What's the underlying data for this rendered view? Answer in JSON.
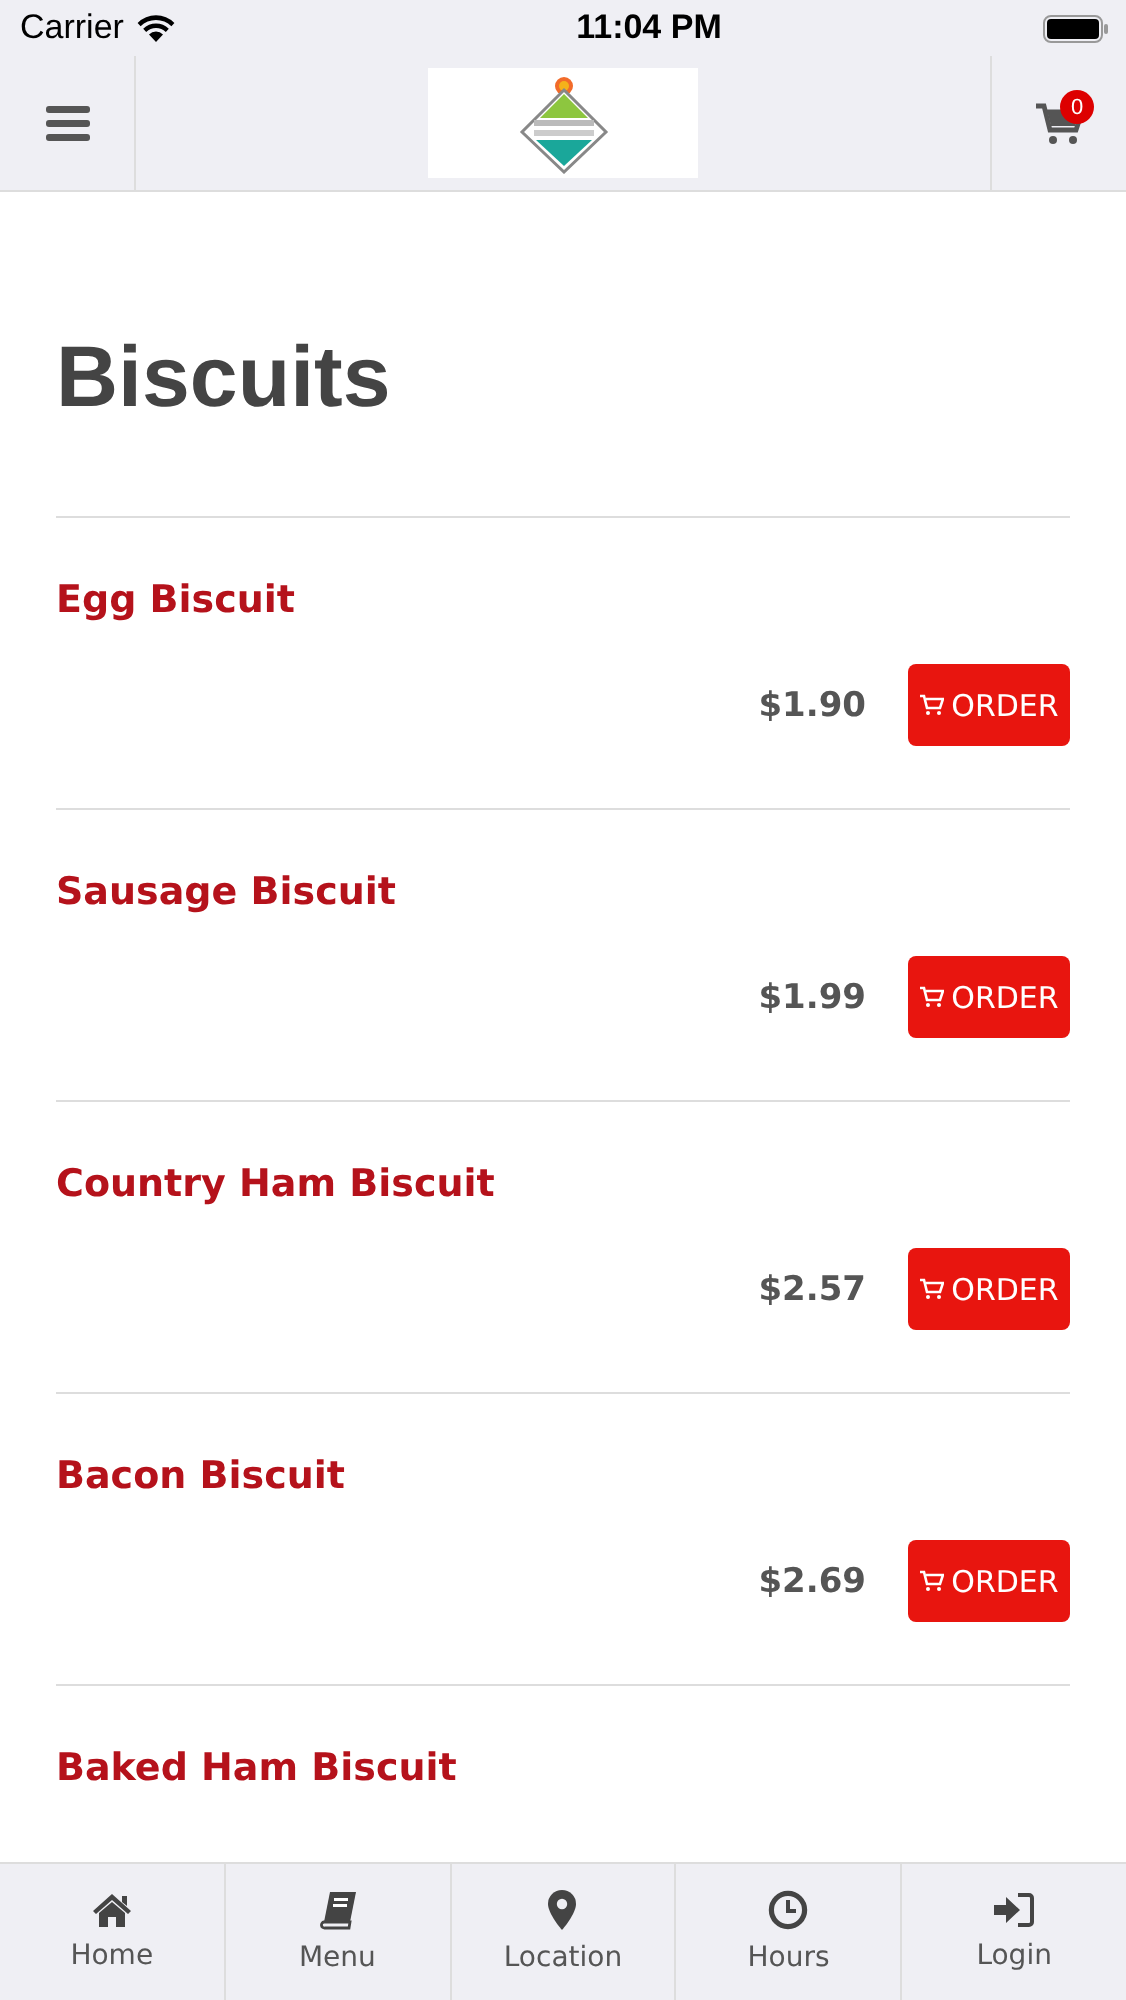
{
  "status_bar": {
    "carrier": "Carrier",
    "time": "11:04 PM"
  },
  "header": {
    "cart_count": "0"
  },
  "page_title": "Biscuits",
  "items": [
    {
      "name": "Egg Biscuit",
      "price": "$1.90",
      "button": "ORDER"
    },
    {
      "name": "Sausage Biscuit",
      "price": "$1.99",
      "button": "ORDER"
    },
    {
      "name": "Country Ham Biscuit",
      "price": "$2.57",
      "button": "ORDER"
    },
    {
      "name": "Bacon Biscuit",
      "price": "$2.69",
      "button": "ORDER"
    },
    {
      "name": "Baked Ham Biscuit"
    }
  ],
  "tab_bar": [
    {
      "label": "Home",
      "kind": "home"
    },
    {
      "label": "Menu",
      "kind": "menu"
    },
    {
      "label": "Location",
      "kind": "location"
    },
    {
      "label": "Hours",
      "kind": "hours"
    },
    {
      "label": "Login",
      "kind": "login"
    }
  ]
}
